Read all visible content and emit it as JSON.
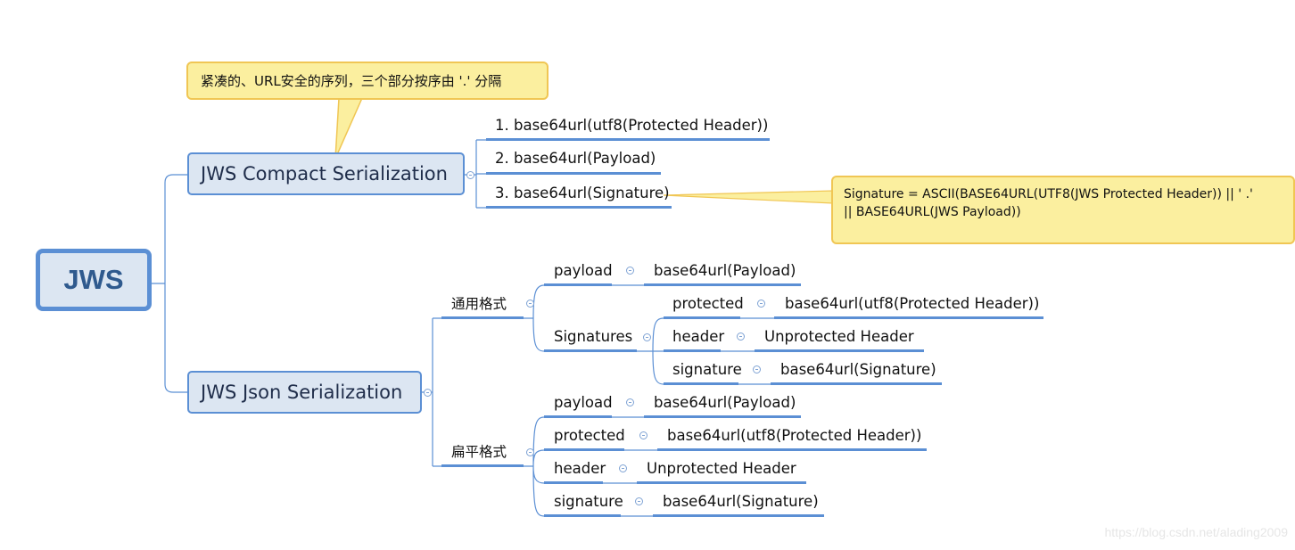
{
  "root": {
    "label": "JWS"
  },
  "compact": {
    "label": "JWS Compact Serialization",
    "callout": "紧凑的、URL安全的序列，三个部分按序由 '.' 分隔",
    "items": [
      "1. base64url(utf8(Protected Header))",
      "2. base64url(Payload)",
      "3. base64url(Signature)"
    ],
    "signature_note_line1": "Signature = ASCII(BASE64URL(UTF8(JWS Protected Header)) || '  .'",
    "signature_note_line2": "|| BASE64URL(JWS Payload))"
  },
  "json": {
    "label": "JWS Json Serialization",
    "general": {
      "label": "通用格式",
      "payload": {
        "key": "payload",
        "value": "base64url(Payload)"
      },
      "signatures": {
        "label": "Signatures",
        "items": [
          {
            "key": "protected",
            "value": "base64url(utf8(Protected Header))"
          },
          {
            "key": "header",
            "value": "Unprotected Header"
          },
          {
            "key": "signature",
            "value": "base64url(Signature)"
          }
        ]
      }
    },
    "flat": {
      "label": "扁平格式",
      "items": [
        {
          "key": "payload",
          "value": "base64url(Payload)"
        },
        {
          "key": "protected",
          "value": "base64url(utf8(Protected Header))"
        },
        {
          "key": "header",
          "value": "Unprotected Header"
        },
        {
          "key": "signature",
          "value": "base64url(Signature)"
        }
      ]
    }
  },
  "watermark": "https://blog.csdn.net/alading2009",
  "colors": {
    "line": "#5b8fd4",
    "node_fill": "#dce6f2",
    "callout_fill": "#fbef9f",
    "callout_border": "#f0c654"
  }
}
